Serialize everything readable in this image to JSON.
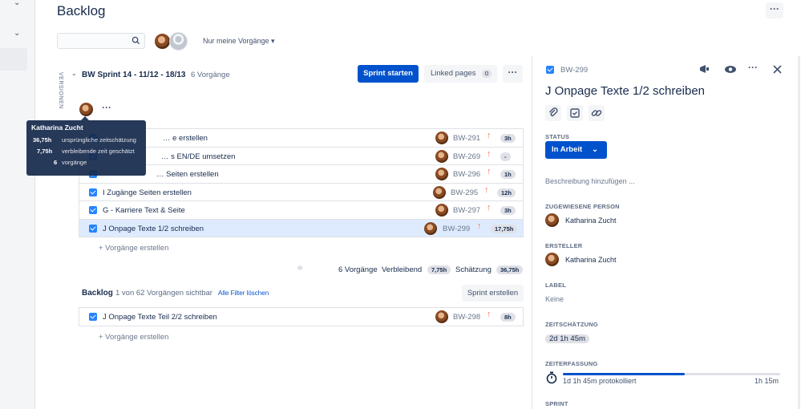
{
  "header": {
    "title": "Backlog",
    "only_mine": "Nur meine Vorgänge ▾"
  },
  "sprint": {
    "title": "BW Sprint 14 - 11/12 - 18/13",
    "count": "6 Vorgänge",
    "versions_label": "VERSIONEN",
    "start_button": "Sprint starten",
    "linked_pages": "Linked pages",
    "linked_count": "0",
    "issues": [
      {
        "summary": "… e erstellen",
        "key": "BW-291",
        "estimate": "3h"
      },
      {
        "summary": "… s EN/DE umsetzen",
        "key": "BW-269",
        "estimate": "-"
      },
      {
        "summary": "… Seiten erstellen",
        "key": "BW-296",
        "estimate": "1h"
      },
      {
        "summary": "I Zugänge Seiten erstellen",
        "key": "BW-295",
        "estimate": "12h"
      },
      {
        "summary": "G - Karriere Text & Seite",
        "key": "BW-297",
        "estimate": "3h"
      },
      {
        "summary": "J Onpage Texte 1/2 schreiben",
        "key": "BW-299",
        "estimate": "17,75h"
      }
    ],
    "create_issue": "+ Vorgänge erstellen",
    "footer": {
      "count": "6 Vorgänge",
      "remaining_label": "Verbleibend",
      "remaining": "7,75h",
      "estimate_label": "Schätzung",
      "estimate": "36,75h"
    }
  },
  "tooltip": {
    "name": "Katharina Zucht",
    "rows": [
      {
        "value": "36,75h",
        "label": "ursprüngliche zeitschätzung"
      },
      {
        "value": "7,75h",
        "label": "verbleibende zeit geschätzt"
      },
      {
        "value": "6",
        "label": "vorgänge"
      }
    ]
  },
  "backlog": {
    "title": "Backlog",
    "visible": "1 von 62 Vorgängen sichtbar",
    "clear_filters": "Alle Filter löschen",
    "create_sprint": "Sprint erstellen",
    "issues": [
      {
        "summary": "J Onpage Texte Teil 2/2 schreiben",
        "key": "BW-298",
        "estimate": "8h"
      }
    ],
    "create_issue": "+ Vorgänge erstellen"
  },
  "detail": {
    "key": "BW-299",
    "title": "J Onpage Texte 1/2 schreiben",
    "status_label": "STATUS",
    "status": "In Arbeit",
    "description_placeholder": "Beschreibung hinzufügen ...",
    "assignee_label": "ZUGEWIESENE PERSON",
    "assignee": "Katharina Zucht",
    "reporter_label": "ERSTELLER",
    "reporter": "Katharina Zucht",
    "labels_label": "LABEL",
    "labels": "Keine",
    "estimate_label": "ZEITSCHÄTZUNG",
    "estimate": "2d 1h 45m",
    "timetracking_label": "ZEITERFASSUNG",
    "logged": "1d 1h 45m protokolliert",
    "remaining": "1h 15m",
    "logged_fraction": 0.56,
    "sprint_label": "SPRINT"
  },
  "colors": {
    "primary": "#0052cc",
    "checkbox": "#2684ff",
    "priority": "#ff7452"
  },
  "icons": [
    "search-icon",
    "chevron-down-icon",
    "more-icon",
    "priority-up-icon",
    "attachment-icon",
    "subtask-icon",
    "link-icon",
    "feedback-icon",
    "watch-icon",
    "close-icon",
    "stopwatch-icon",
    "drag-handle-icon"
  ]
}
